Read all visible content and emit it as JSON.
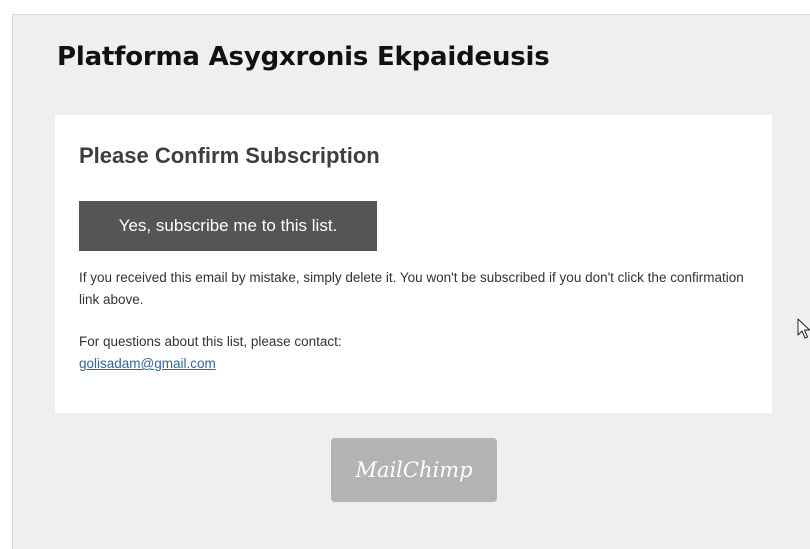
{
  "header": {
    "title": "Platforma Asygxronis Ekpaideusis"
  },
  "card": {
    "heading": "Please Confirm Subscription",
    "confirm_button_label": "Yes, subscribe me to this list.",
    "mistake_text": "If you received this email by mistake, simply delete it. You won't be subscribed if you don't click the confirmation link above.",
    "contact_prefix": "For questions about this list, please contact:",
    "contact_email": "golisadam@gmail.com"
  },
  "footer": {
    "brand_logo_text": "MailChimp"
  },
  "colors": {
    "page_background": "#efefef",
    "card_background": "#ffffff",
    "button_background": "#555555",
    "link": "#336699",
    "badge_background": "#b3b3b3"
  },
  "icons": {
    "cursor": "mouse-pointer-icon"
  }
}
